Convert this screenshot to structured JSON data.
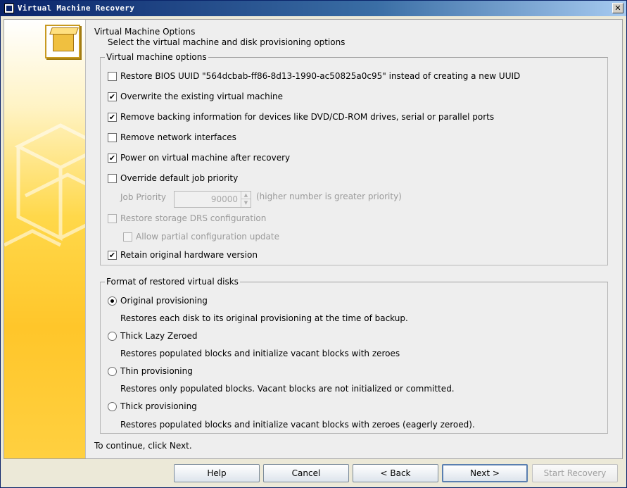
{
  "window": {
    "title": "Virtual Machine Recovery",
    "close_label": "✕"
  },
  "header": {
    "title": "Virtual Machine Options",
    "subtitle": "Select the virtual machine and disk provisioning options"
  },
  "vm_options": {
    "legend": "Virtual machine options",
    "restore_bios_uuid": {
      "label": "Restore BIOS UUID \"564dcbab-ff86-8d13-1990-ac50825a0c95\" instead of creating a new UUID",
      "checked": false
    },
    "overwrite_vm": {
      "label": "Overwrite the existing virtual machine",
      "checked": true
    },
    "remove_backing": {
      "label": "Remove backing information for devices like DVD/CD-ROM drives, serial or parallel ports",
      "checked": true
    },
    "remove_network": {
      "label": "Remove network interfaces",
      "checked": false
    },
    "power_on": {
      "label": "Power on virtual machine after recovery",
      "checked": true
    },
    "override_priority": {
      "label": "Override default job priority",
      "checked": false
    },
    "job_priority": {
      "label": "Job Priority",
      "value": "90000",
      "hint": "(higher number is greater priority)"
    },
    "restore_drs": {
      "label": "Restore storage DRS configuration",
      "checked": false
    },
    "allow_partial": {
      "label": "Allow partial configuration update",
      "checked": false
    },
    "retain_hw": {
      "label": "Retain original hardware version",
      "checked": true
    }
  },
  "disk_format": {
    "legend": "Format of restored virtual disks",
    "options": [
      {
        "label": "Original provisioning",
        "desc": "Restores each disk to its original provisioning at the time of backup.",
        "selected": true
      },
      {
        "label": "Thick Lazy Zeroed",
        "desc": "Restores populated blocks and initialize vacant blocks with zeroes",
        "selected": false
      },
      {
        "label": "Thin provisioning",
        "desc": "Restores only populated blocks. Vacant blocks are not initialized or committed.",
        "selected": false
      },
      {
        "label": "Thick provisioning",
        "desc": "Restores populated blocks and initialize vacant blocks with zeroes (eagerly zeroed).",
        "selected": false
      }
    ]
  },
  "footer": {
    "continue_text": "To continue, click Next.",
    "help": "Help",
    "cancel": "Cancel",
    "back": "< Back",
    "next": "Next >",
    "start": "Start Recovery"
  }
}
